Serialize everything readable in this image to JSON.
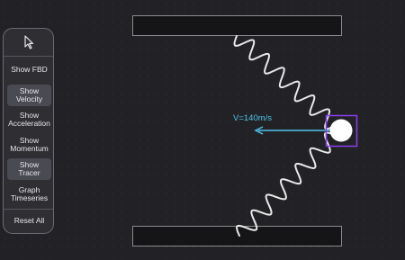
{
  "toolbar": {
    "cursor_icon": "pointer-arrow-icon",
    "buttons": [
      {
        "label": "Show FBD",
        "active": false
      },
      {
        "label": "Show\nVelocity",
        "active": true
      },
      {
        "label": "Show\nAcceleration",
        "active": false
      },
      {
        "label": "Show\nMomentum",
        "active": false
      },
      {
        "label": "Show\nTracer",
        "active": true
      },
      {
        "label": "Graph\nTimeseries",
        "active": false
      },
      {
        "label": "Reset All",
        "active": false
      }
    ]
  },
  "simulation": {
    "velocity_label": "V=140m/s",
    "colors": {
      "background": "#222226",
      "wall_fill": "#151517",
      "wall_border": "#8a8a8f",
      "tracer": "#e8e8e8",
      "velocity_arrow": "#4ec3ea",
      "selection": "#8a3df0",
      "ball": "#ffffff"
    }
  }
}
